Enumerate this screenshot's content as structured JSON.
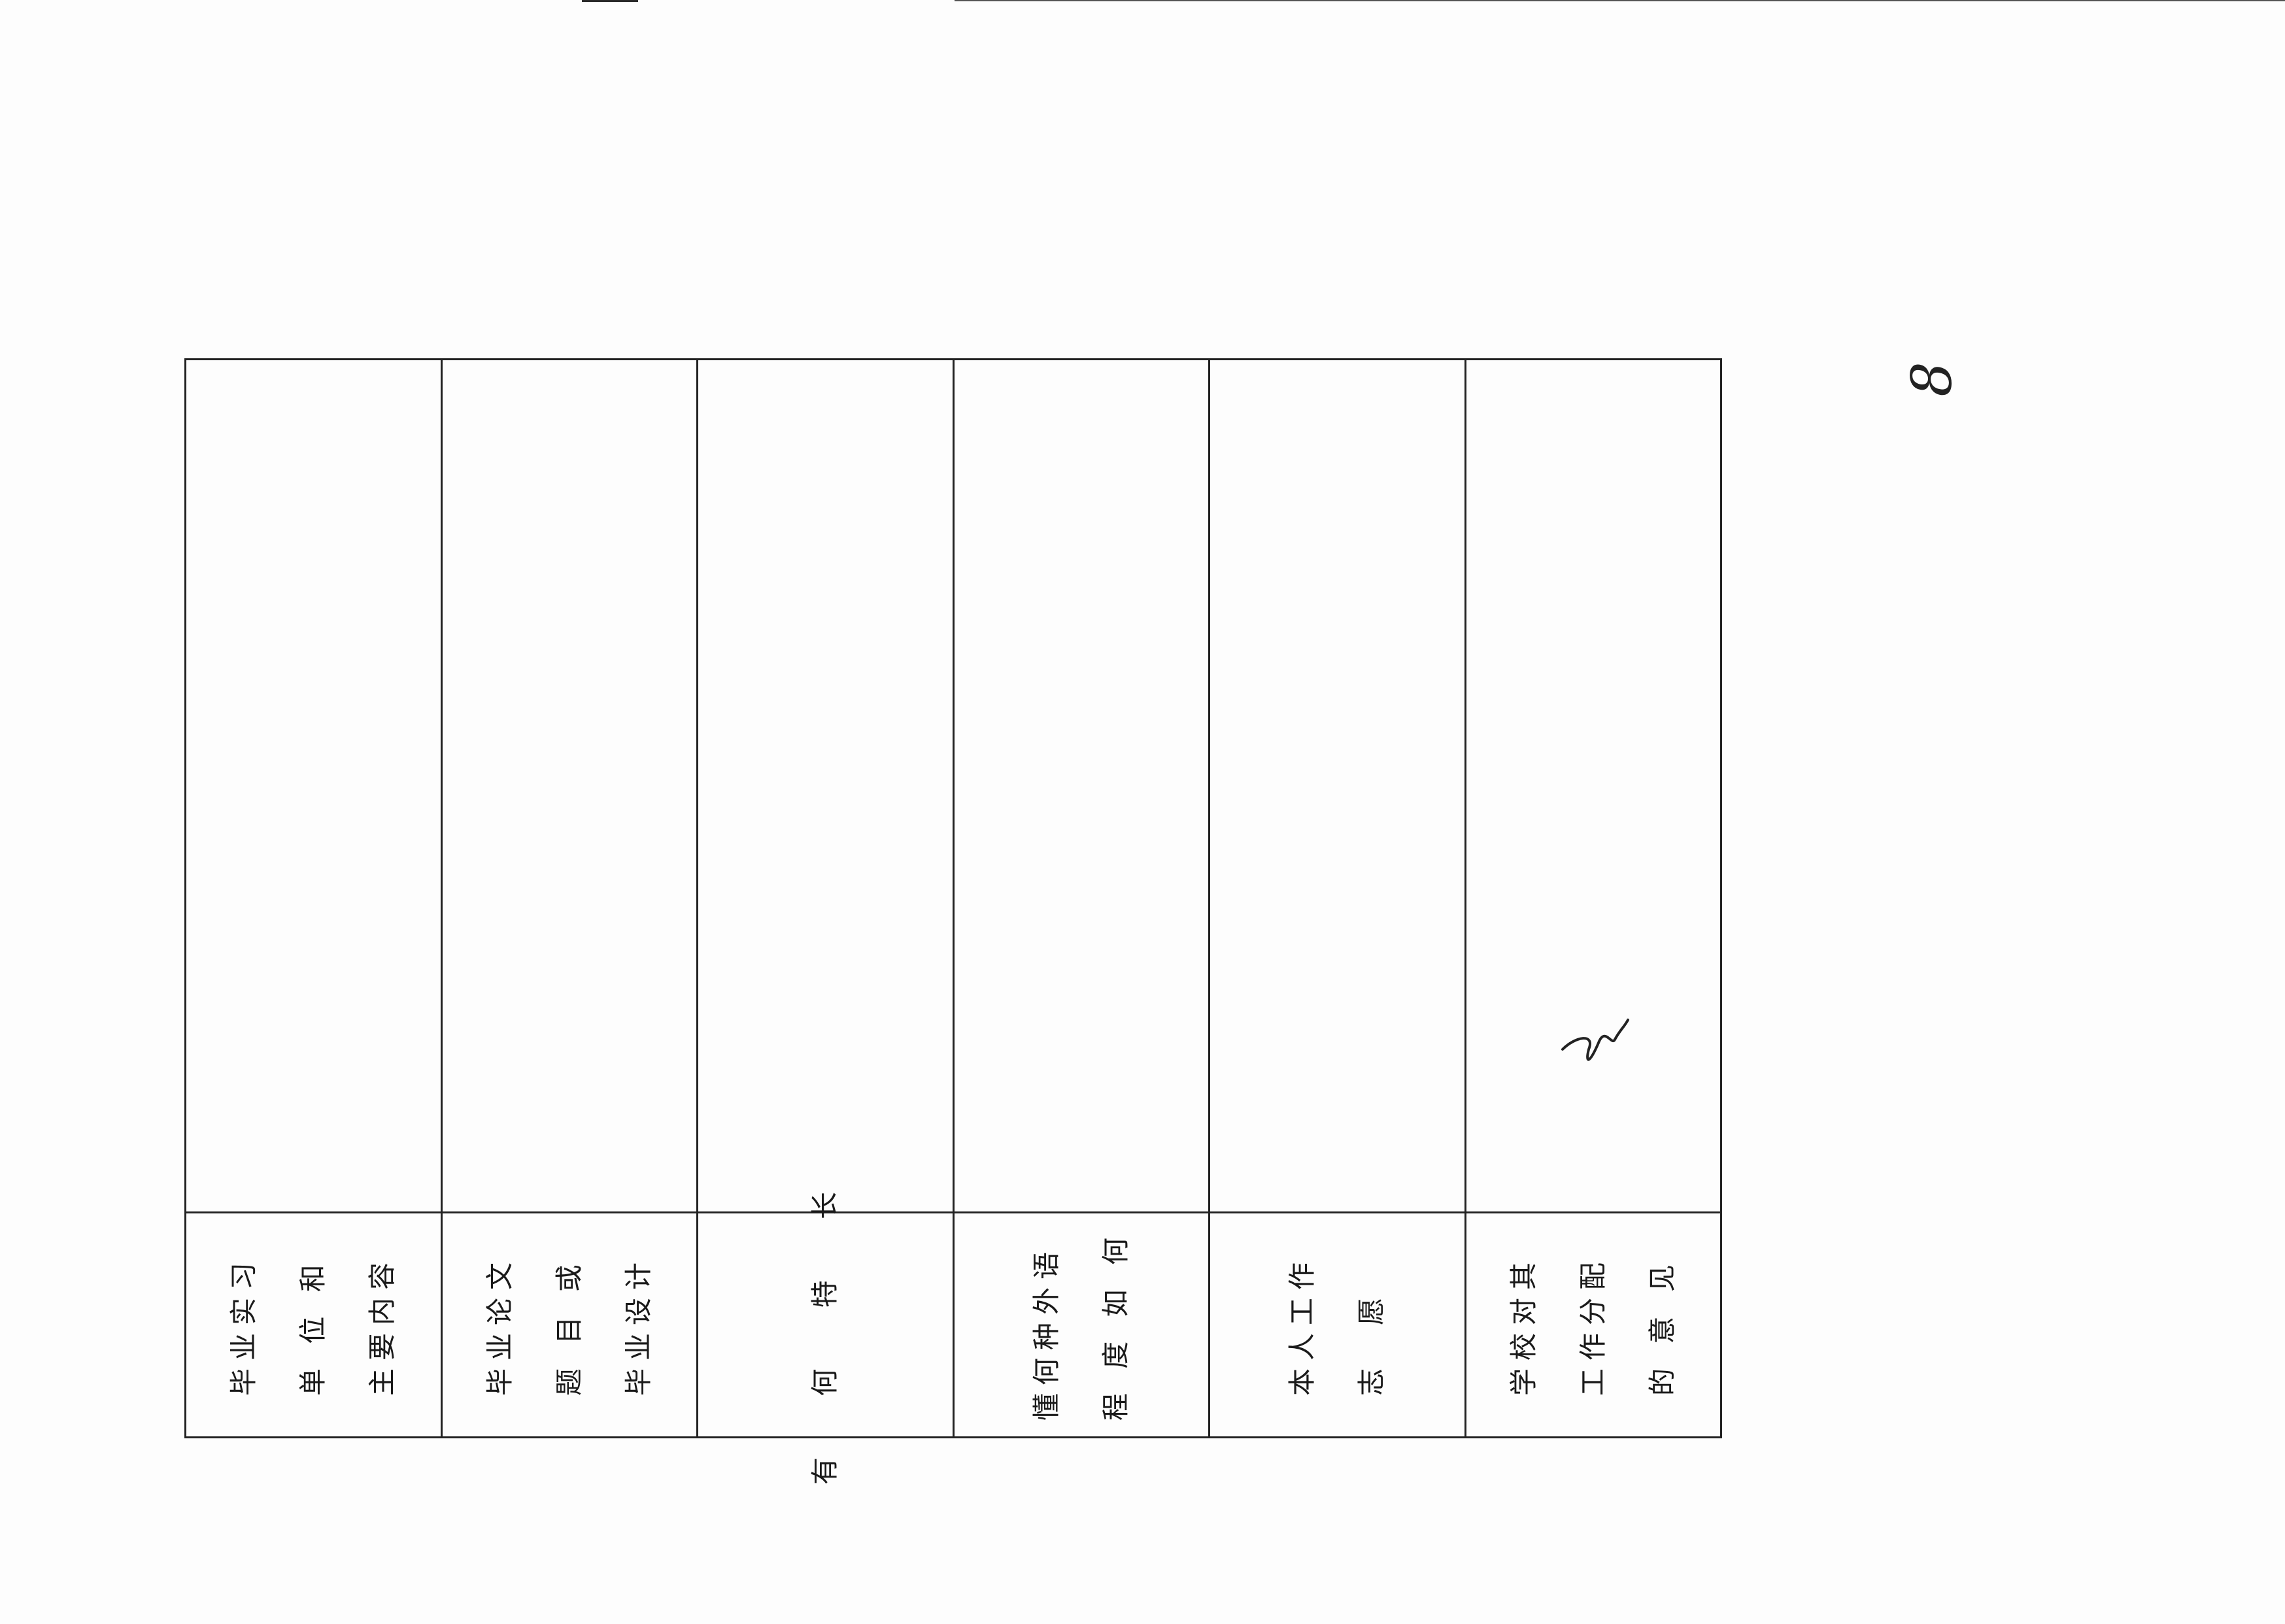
{
  "page": {
    "number": "8"
  },
  "table": {
    "rows": [
      {
        "id": "internship",
        "label_lines": [
          "毕业实习",
          "单 位 和",
          "主要内容"
        ],
        "value": ""
      },
      {
        "id": "thesis",
        "label_lines": [
          "毕业论文",
          "题 目 或",
          "毕业设计"
        ],
        "value": ""
      },
      {
        "id": "specialty",
        "label_lines": [
          "有 何 特 长"
        ],
        "value": ""
      },
      {
        "id": "languages",
        "label_lines": [
          "懂何种外语",
          "程 度 如 何"
        ],
        "value": ""
      },
      {
        "id": "job-wish",
        "label_lines": [
          "本人工作",
          "志　愿"
        ],
        "value": ""
      },
      {
        "id": "school-opinion",
        "label_lines": [
          "学校对其",
          "工作分配",
          "的 意 见"
        ],
        "value": ""
      }
    ]
  },
  "colors": {
    "ink": "#222222",
    "paper": "#fdfdfd"
  }
}
